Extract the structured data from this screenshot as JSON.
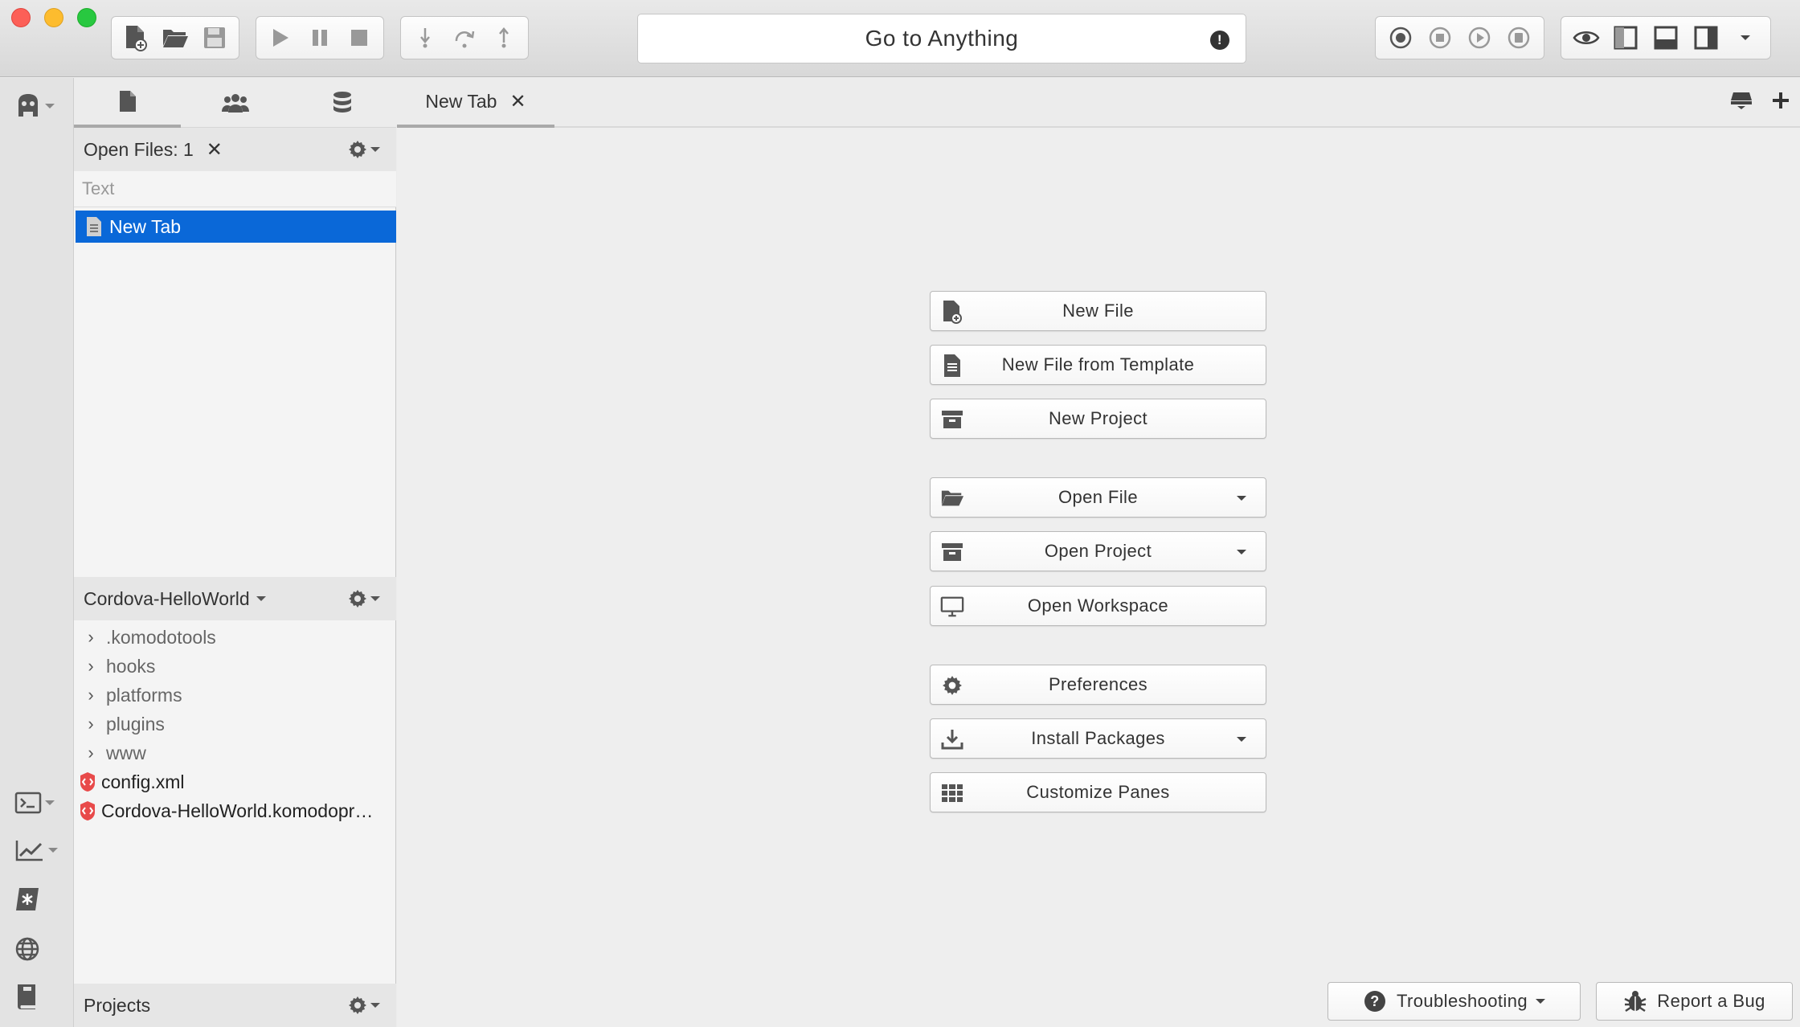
{
  "toolbar": {
    "goto_label": "Go to Anything",
    "file_buttons": [
      "new-file-icon",
      "open-folder-icon",
      "save-icon"
    ],
    "debug_buttons": [
      "play-icon",
      "pause-icon",
      "stop-icon"
    ],
    "step_buttons": [
      "step-in-icon",
      "step-over-icon",
      "step-out-icon"
    ],
    "macro_buttons": [
      "record-icon",
      "stop-record-icon",
      "play-macro-icon",
      "save-macro-icon"
    ],
    "view_buttons": [
      "eye-icon",
      "left-pane-icon",
      "bottom-pane-icon",
      "right-pane-icon"
    ]
  },
  "left_panel": {
    "open_files": {
      "header_label": "Open Files: 1",
      "filter_placeholder": "Text",
      "items": [
        {
          "label": "New Tab"
        }
      ]
    },
    "project": {
      "header_label": "Cordova-HelloWorld",
      "items": [
        {
          "label": ".komodotools",
          "type": "folder"
        },
        {
          "label": "hooks",
          "type": "folder"
        },
        {
          "label": "platforms",
          "type": "folder"
        },
        {
          "label": "plugins",
          "type": "folder"
        },
        {
          "label": "www",
          "type": "folder"
        },
        {
          "label": "config.xml",
          "type": "file"
        },
        {
          "label": "Cordova-HelloWorld.komodopr…",
          "type": "file"
        }
      ]
    },
    "projects_footer_label": "Projects"
  },
  "main": {
    "tab": {
      "label": "New Tab"
    },
    "start_buttons": [
      {
        "label": "New File",
        "icon": "new-file-icon",
        "dropdown": false
      },
      {
        "label": "New File from Template",
        "icon": "template-icon",
        "dropdown": false
      },
      {
        "label": "New Project",
        "icon": "project-box-icon",
        "dropdown": false
      },
      {
        "label": "Open File",
        "icon": "open-folder-icon",
        "dropdown": true
      },
      {
        "label": "Open Project",
        "icon": "project-box-icon",
        "dropdown": true
      },
      {
        "label": "Open Workspace",
        "icon": "monitor-icon",
        "dropdown": false
      },
      {
        "label": "Preferences",
        "icon": "gear-icon",
        "dropdown": false
      },
      {
        "label": "Install Packages",
        "icon": "download-icon",
        "dropdown": true
      },
      {
        "label": "Customize Panes",
        "icon": "grid-icon",
        "dropdown": false
      }
    ],
    "troubleshooting_label": "Troubleshooting",
    "report_bug_label": "Report a Bug"
  },
  "colors": {
    "selection": "#0a68d8",
    "xml_icon": "#e84a4a"
  }
}
